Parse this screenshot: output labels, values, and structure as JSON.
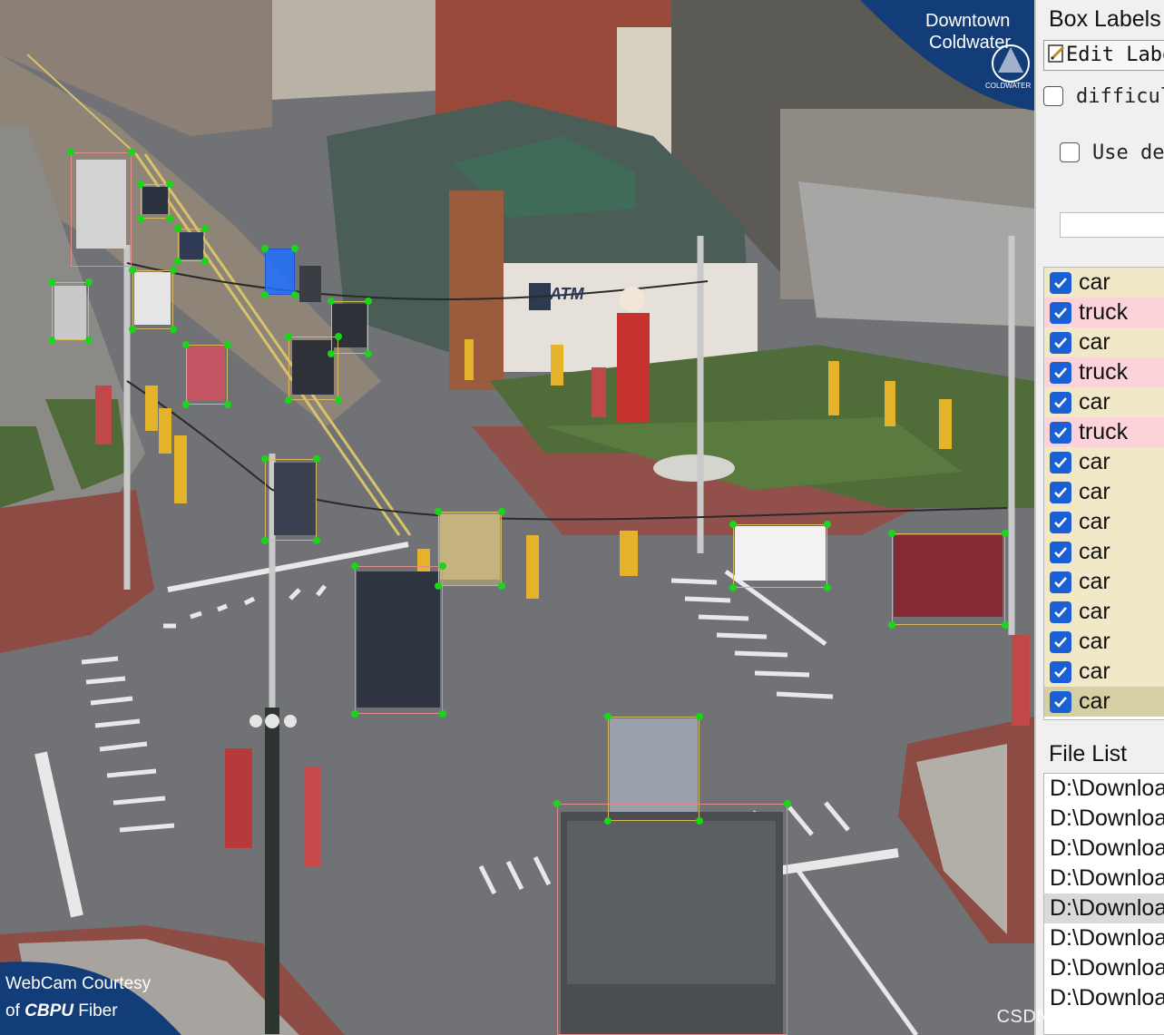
{
  "overlay": {
    "brand_top_line1": "Downtown",
    "brand_top_line2": "Coldwater",
    "brand_top_small": "COLDWATER",
    "atm_sign": "ATM",
    "webcam_line1": "WebCam Courtesy",
    "webcam_line2_prefix": "of",
    "webcam_line2_brand": "CBPU",
    "webcam_line2_suffix": "Fiber",
    "watermark": "CSDN @王哈哈^_^"
  },
  "box_labels": {
    "title": "Box Labels",
    "edit_label": "Edit Label",
    "difficult_label": "difficult",
    "use_default_label": "Use default label",
    "default_label_value": "",
    "items": [
      {
        "label": "car",
        "checked": true
      },
      {
        "label": "truck",
        "checked": true
      },
      {
        "label": "car",
        "checked": true
      },
      {
        "label": "truck",
        "checked": true
      },
      {
        "label": "car",
        "checked": true
      },
      {
        "label": "truck",
        "checked": true
      },
      {
        "label": "car",
        "checked": true
      },
      {
        "label": "car",
        "checked": true
      },
      {
        "label": "car",
        "checked": true
      },
      {
        "label": "car",
        "checked": true
      },
      {
        "label": "car",
        "checked": true
      },
      {
        "label": "car",
        "checked": true
      },
      {
        "label": "car",
        "checked": true
      },
      {
        "label": "car",
        "checked": true
      },
      {
        "label": "car",
        "checked": true
      }
    ],
    "active_index": 14
  },
  "file_list": {
    "title": "File List",
    "items": [
      "D:\\Downloa",
      "D:\\Downloa",
      "D:\\Downloa",
      "D:\\Downloa",
      "D:\\Downloa",
      "D:\\Downloa",
      "D:\\Downloa",
      "D:\\Downloa"
    ],
    "active_index": 4
  },
  "colors": {
    "checkbox_blue": "#1b5fd4",
    "car_row": "#f1e8c8",
    "truck_row": "#fbd3d8",
    "handle_green": "#18d618",
    "truck_box": "#e48a8a",
    "car_box": "#d8b85e"
  }
}
